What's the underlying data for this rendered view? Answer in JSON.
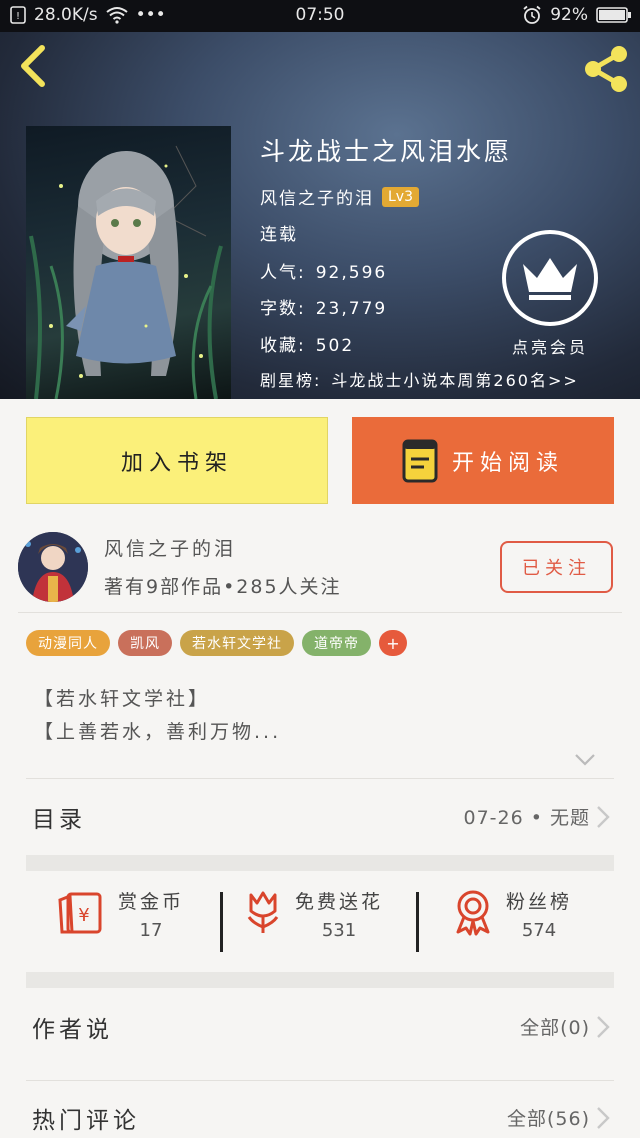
{
  "status_bar": {
    "speed": "28.0K/s",
    "dots": "•••",
    "time": "07:50",
    "battery": "92%"
  },
  "book": {
    "title": "斗龙战士之风泪水愿",
    "author": "风信之子的泪",
    "level": "Lv3",
    "status": "连载",
    "popularity_label": "人气:",
    "popularity": "92,596",
    "words_label": "字数:",
    "words": "23,779",
    "favorites_label": "收藏:",
    "favorites": "502",
    "rank_label": "剧星榜:",
    "rank": "斗龙战士小说本周第260名>>"
  },
  "vip": {
    "label": "点亮会员"
  },
  "actions": {
    "add_shelf": "加入书架",
    "start_reading": "开始阅读"
  },
  "author_card": {
    "name": "风信之子的泪",
    "stats": "著有9部作品•285人关注",
    "follow": "已关注"
  },
  "tags": [
    {
      "label": "动漫同人",
      "color": "#e8a33c"
    },
    {
      "label": "凯风",
      "color": "#c9705b"
    },
    {
      "label": "若水轩文学社",
      "color": "#c9a349"
    },
    {
      "label": "道帝帝",
      "color": "#84b26a"
    }
  ],
  "tag_plus": "+",
  "intro": {
    "line1": "【若水轩文学社】",
    "line2": "【上善若水，善利万物..."
  },
  "catalog": {
    "label": "目录",
    "latest": "07-26 • 无题"
  },
  "stats": {
    "reward_label": "赏金币",
    "reward_value": "17",
    "flowers_label": "免费送花",
    "flowers_value": "531",
    "fans_label": "粉丝榜",
    "fans_value": "574"
  },
  "author_says": {
    "label": "作者说",
    "all": "全部(0)"
  },
  "hot_comments": {
    "label": "热门评论",
    "all": "全部(56)"
  }
}
